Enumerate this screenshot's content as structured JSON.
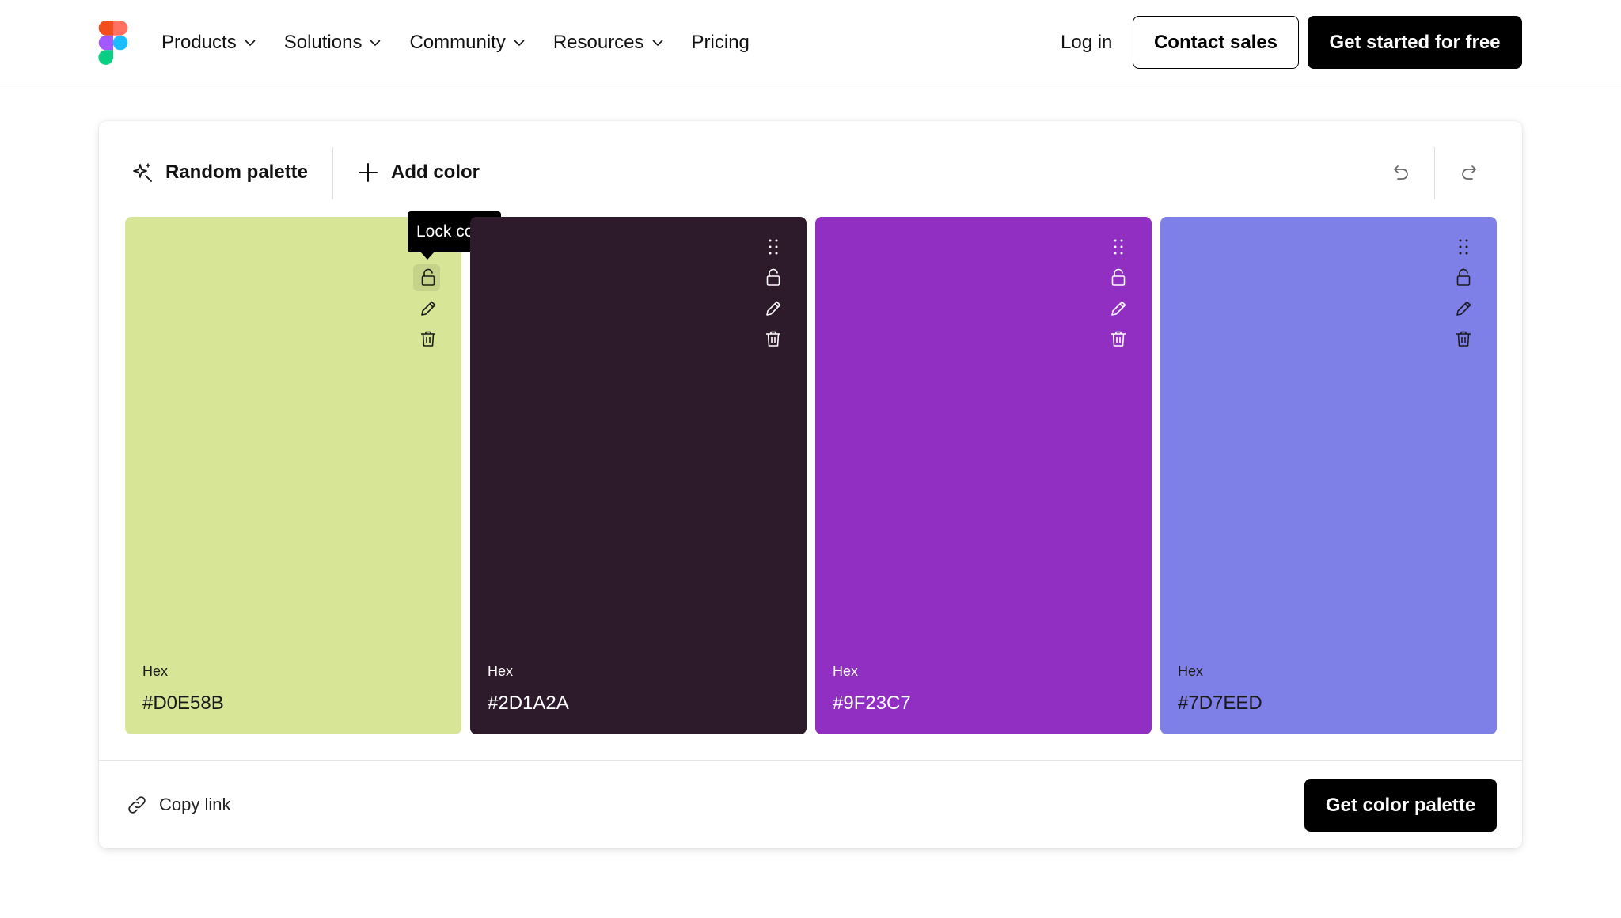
{
  "header": {
    "nav": [
      {
        "label": "Products",
        "has_dropdown": true
      },
      {
        "label": "Solutions",
        "has_dropdown": true
      },
      {
        "label": "Community",
        "has_dropdown": true
      },
      {
        "label": "Resources",
        "has_dropdown": true
      },
      {
        "label": "Pricing",
        "has_dropdown": false
      }
    ],
    "login_label": "Log in",
    "contact_sales_label": "Contact sales",
    "get_started_label": "Get started for free"
  },
  "toolbar": {
    "random_palette_label": "Random palette",
    "add_color_label": "Add color"
  },
  "tooltip": {
    "text": "Lock color"
  },
  "swatches": [
    {
      "hex_label": "Hex",
      "hex": "#D0E58B",
      "fill": "#d6e596",
      "text_color": "#1a1a1a"
    },
    {
      "hex_label": "Hex",
      "hex": "#2D1A2A",
      "fill": "#2d1a2a",
      "text_color": "#ffffff"
    },
    {
      "hex_label": "Hex",
      "hex": "#9F23C7",
      "fill": "#922fc3",
      "text_color": "#ffffff"
    },
    {
      "hex_label": "Hex",
      "hex": "#7D7EED",
      "fill": "#7f7fe8",
      "text_color": "#1a1a1a"
    }
  ],
  "footer": {
    "copy_link_label": "Copy link",
    "get_palette_label": "Get color palette"
  },
  "icons": [
    "figma-logo-icon",
    "chevron-down-icon",
    "sparkle-icon",
    "plus-icon",
    "undo-icon",
    "redo-icon",
    "drag-handle-icon",
    "lock-icon",
    "pencil-icon",
    "trash-icon",
    "link-icon"
  ]
}
